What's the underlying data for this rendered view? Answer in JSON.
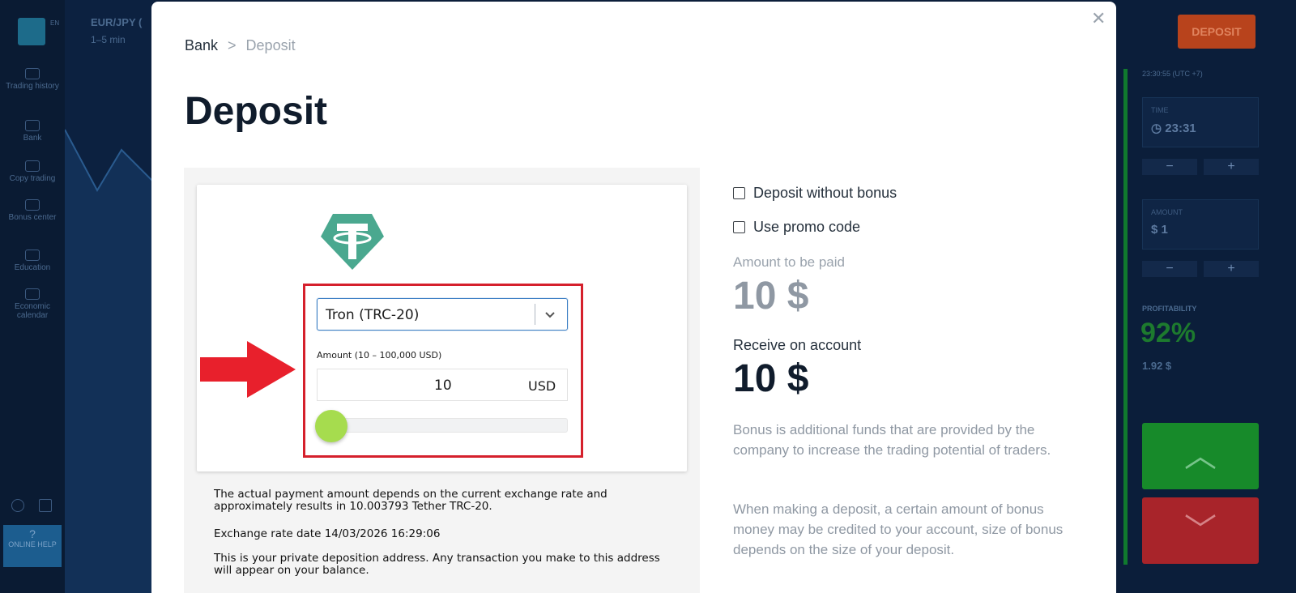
{
  "background": {
    "pair": "EUR/JPY (",
    "pair_sub": "1–5 min",
    "logo_tag": "EN",
    "sidebar": [
      {
        "label": "Trading history"
      },
      {
        "label": "Bank"
      },
      {
        "label": "Copy trading"
      },
      {
        "label": "Bonus center"
      },
      {
        "label": "Education"
      },
      {
        "label": "Economic calendar"
      }
    ],
    "help": "ONLINE HELP",
    "deposit_button": "DEPOSIT",
    "clock": "23:30:55 (UTC +7)",
    "time_label": "TIME",
    "time_value": "23:31",
    "amount_label": "AMOUNT",
    "amount_value": "$ 1",
    "minus": "−",
    "plus": "+",
    "profitability_label": "PROFITABILITY",
    "profitability_value": "92%",
    "profit_amount": "1.92 $"
  },
  "modal": {
    "breadcrumb": {
      "root": "Bank",
      "separator": ">",
      "current": "Deposit"
    },
    "title": "Deposit",
    "payment": {
      "network": "Tron (TRC-20)",
      "amount_label": "Amount (10 – 100,000 USD)",
      "amount_value": "10",
      "currency": "USD",
      "slider_fraction": 0.0
    },
    "info": {
      "rate_note": "The actual payment amount depends on the current exchange rate and approximately results in 10.003793 Tether TRC-20.",
      "rate_date": "Exchange rate date 14/03/2026 16:29:06",
      "address_note": "This is your private deposition address. Any transaction you make to this address will appear on your balance."
    },
    "options": {
      "no_bonus": "Deposit without bonus",
      "promo": "Use promo code"
    },
    "summary": {
      "pay_label": "Amount to be paid",
      "pay_value": "10 $",
      "receive_label": "Receive on account",
      "receive_value": "10 $"
    },
    "bonus_text_1": "Bonus is additional funds that are provided by the company to increase the trading potential of traders.",
    "bonus_text_2": "When making a deposit, a certain amount of bonus money may be credited to your account, size of bonus depends on the size of your deposit."
  }
}
